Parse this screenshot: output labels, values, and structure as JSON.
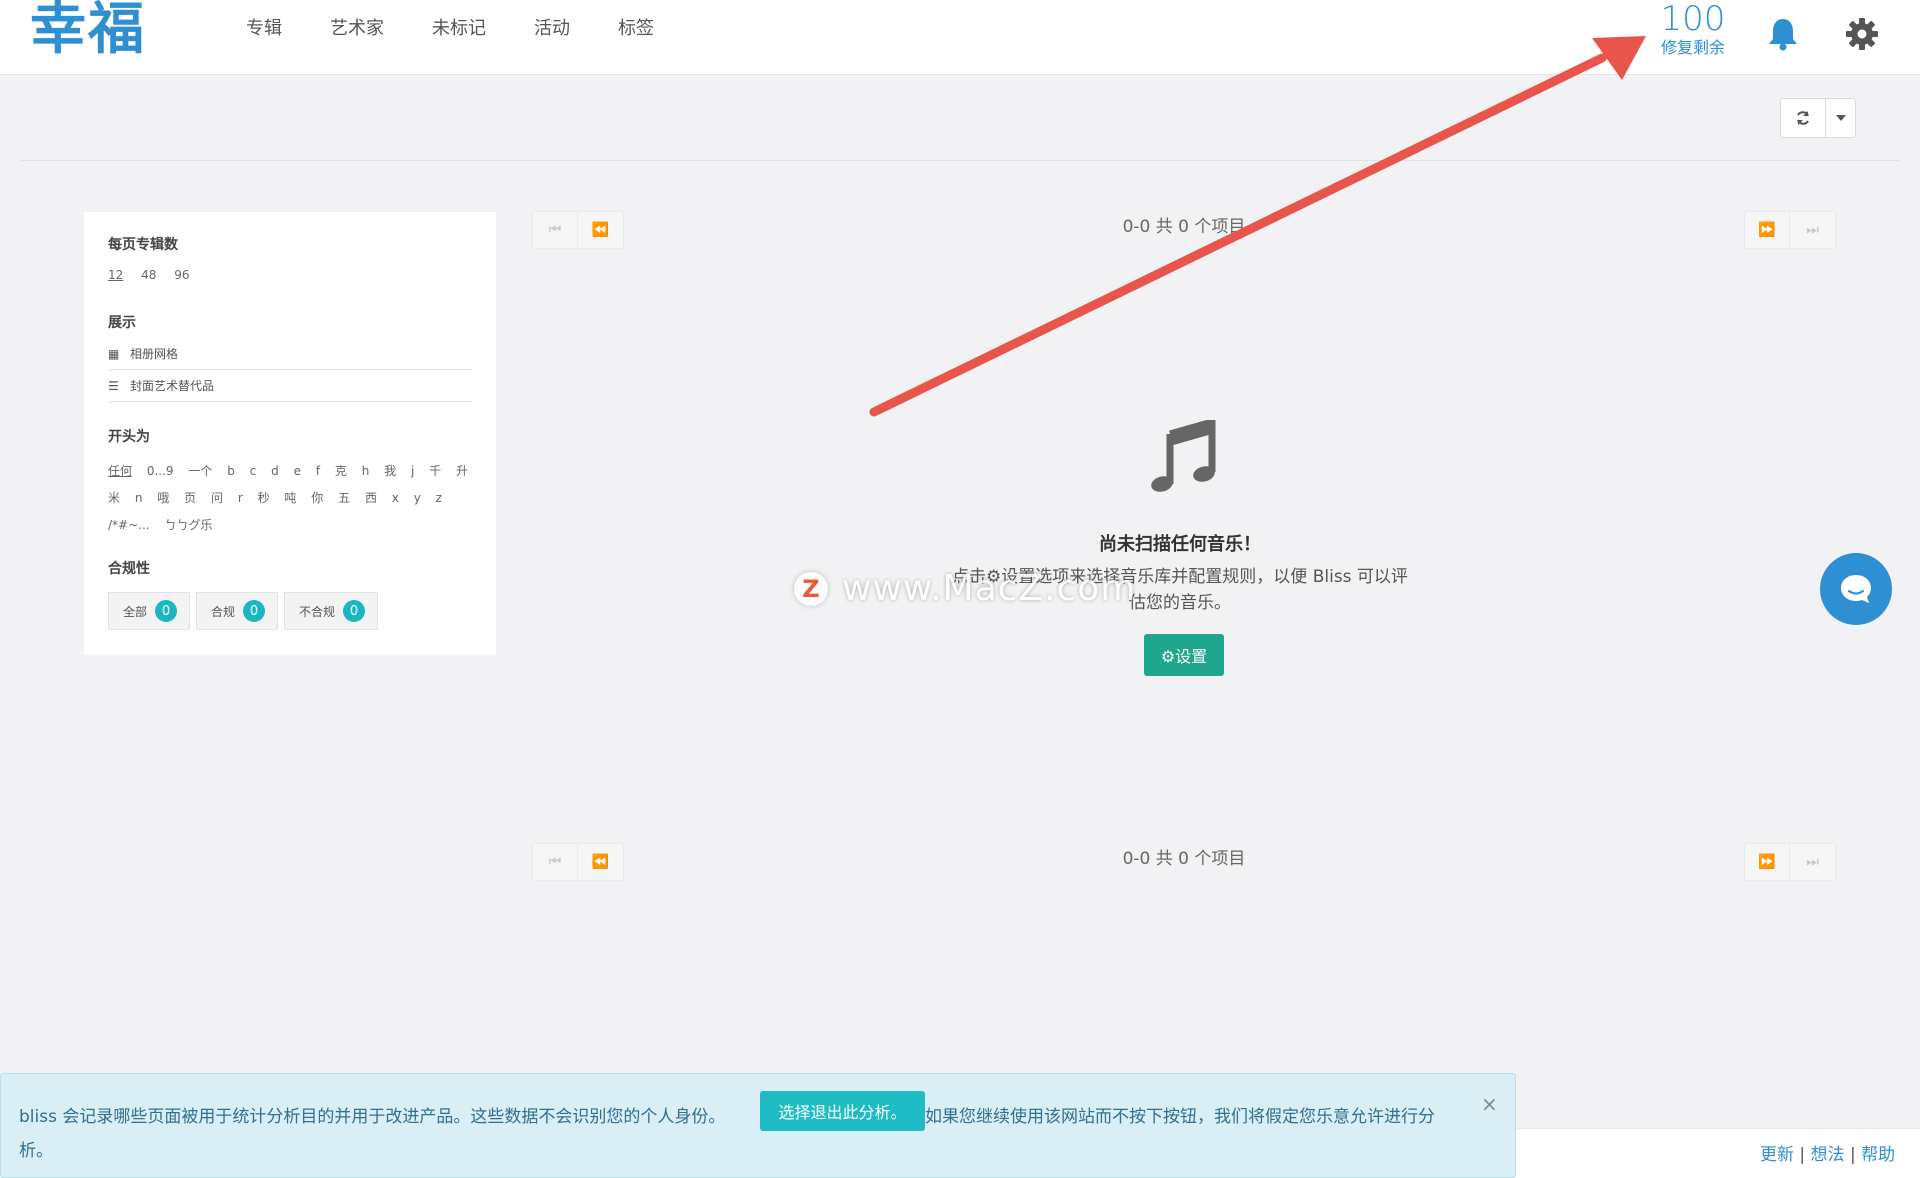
{
  "app": {
    "logo": "幸福"
  },
  "nav": [
    {
      "label": "专辑"
    },
    {
      "label": "艺术家"
    },
    {
      "label": "未标记"
    },
    {
      "label": "活动"
    },
    {
      "label": "标签"
    }
  ],
  "fixes": {
    "count": "100",
    "label": "修复剩余"
  },
  "sidebar": {
    "per_page_title": "每页专辑数",
    "per_page_options": [
      "12",
      "48",
      "96"
    ],
    "display_title": "展示",
    "display_options": [
      {
        "label": "相册网格",
        "icon": "grid-icon"
      },
      {
        "label": "封面艺术替代品",
        "icon": "list-icon"
      }
    ],
    "starts_with_title": "开头为",
    "letters_row1": [
      "任何",
      "0...9",
      "一个",
      "b",
      "c",
      "d",
      "e",
      "f",
      "克",
      "h",
      "我",
      "j",
      "千",
      "升"
    ],
    "letters_row2": [
      "米",
      "n",
      "哦",
      "页",
      "问",
      "r",
      "秒",
      "吨",
      "你",
      "五",
      "西",
      "x",
      "y",
      "z"
    ],
    "letters_row3": [
      "/*#~...",
      "ㄅㄅグ乐"
    ],
    "compliance_title": "合规性",
    "compliance": [
      {
        "label": "全部",
        "count": "0"
      },
      {
        "label": "合规",
        "count": "0"
      },
      {
        "label": "不合规",
        "count": "0"
      }
    ]
  },
  "pager": {
    "count_text": "0-0 共 0 个项目"
  },
  "empty": {
    "title": "尚未扫描任何音乐！",
    "desc_line1": "点击⚙设置选项来选择音乐库并配置规则，以便 Bliss 可以评",
    "desc_line2": "估您的音乐。",
    "setup_button": "⚙设置"
  },
  "watermark": {
    "text": "www.MacZ.com",
    "letter": "Z"
  },
  "cookie": {
    "text1": "bliss 会记录哪些页面被用于统计分析目的并用于改进产品。这些数据不会识别您的个人身份。",
    "optout": "选择退出此分析。",
    "text2": "如果您继续使用该网站而不按下按钮，我们将假定您乐意允许进行分",
    "text3": "析。",
    "close": "×"
  },
  "footer": {
    "update": "更新",
    "ideas": "想法",
    "help": "帮助",
    "sep": "|"
  },
  "colors": {
    "accent": "#2f8fd3",
    "teal": "#1fa78e",
    "badge": "#1ab7c0",
    "arrow": "#e8554b"
  }
}
